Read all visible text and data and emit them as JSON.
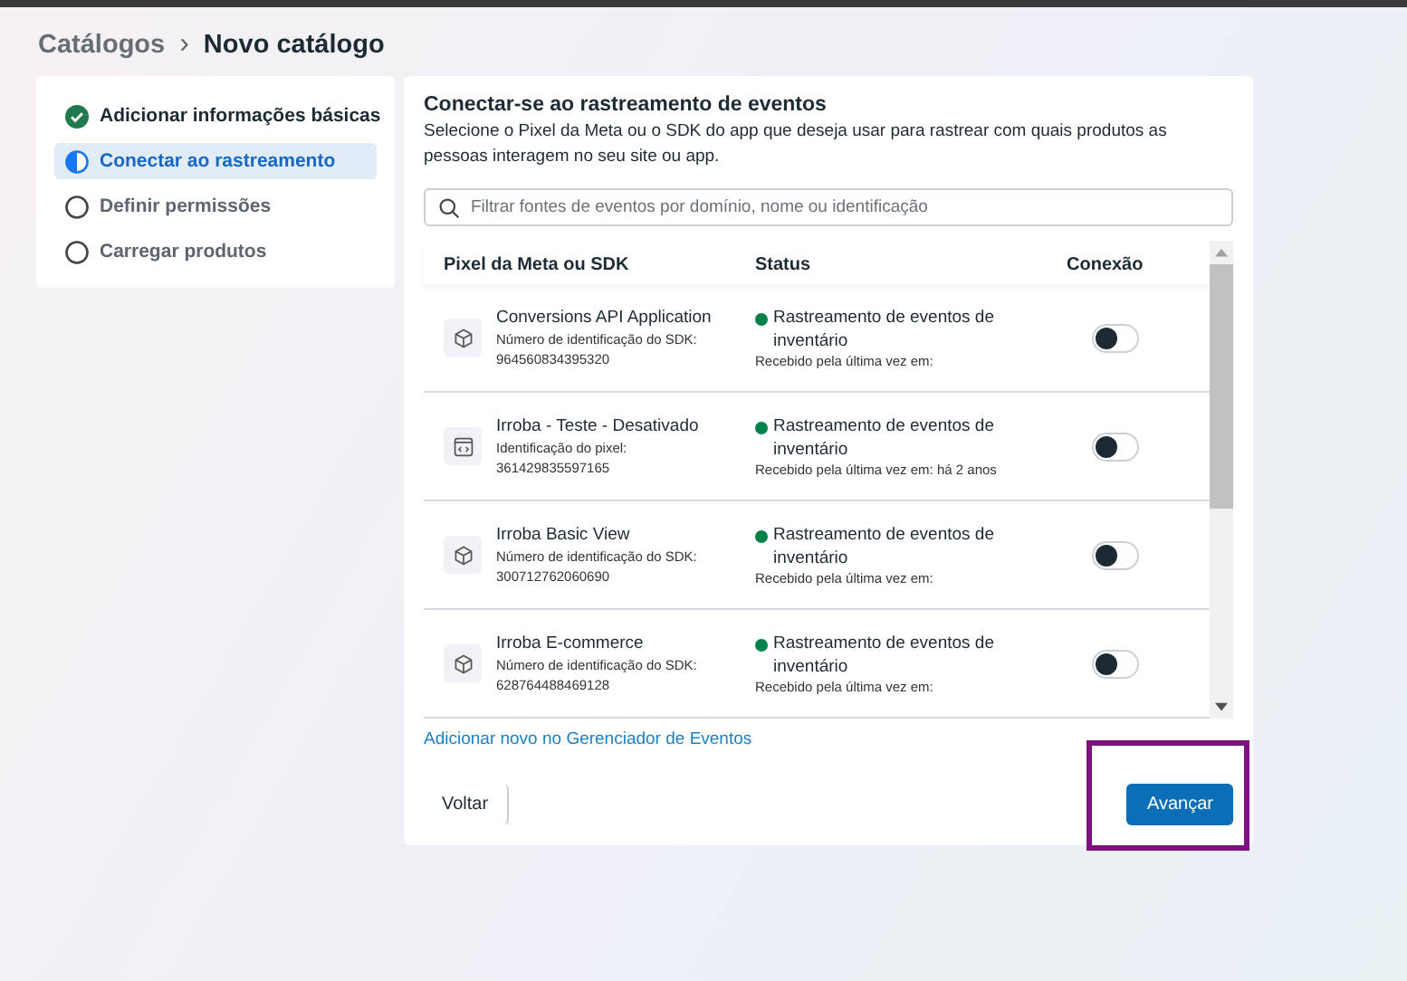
{
  "breadcrumb": {
    "parent": "Catálogos",
    "separator": "›",
    "current": "Novo catálogo"
  },
  "steps": [
    {
      "label": "Adicionar informações básicas",
      "kind": "done",
      "selected": false
    },
    {
      "label": "Conectar ao rastreamento",
      "kind": "current",
      "selected": true
    },
    {
      "label": "Definir permissões",
      "kind": "pending",
      "selected": false
    },
    {
      "label": "Carregar produtos",
      "kind": "pending",
      "selected": false
    }
  ],
  "panel": {
    "title": "Conectar-se ao rastreamento de eventos",
    "description": "Selecione o Pixel da Meta ou o SDK do app que deseja usar para rastrear com quais produtos as pessoas interagem no seu site ou app.",
    "search": {
      "placeholder": "Filtrar fontes de eventos por domínio, nome ou identificação"
    }
  },
  "table": {
    "columns": [
      "Pixel da Meta ou SDK",
      "Status",
      "Conexão"
    ],
    "rows": [
      {
        "kind": "sdk",
        "name": "Conversions API Application",
        "id_label": "Número de identificação do SDK:",
        "id": "964560834395320",
        "status": "Rastreamento de eventos de inventário",
        "color": "#00804a",
        "received": "Recebido pela última vez em:",
        "on": false
      },
      {
        "kind": "pixel",
        "name": "Irroba - Teste - Desativado",
        "id_label": "Identificação do pixel:",
        "id": "361429835597165",
        "status": "Rastreamento de eventos de inventário",
        "color": "#00804a",
        "received": "Recebido pela última vez em: há 2 anos",
        "on": false
      },
      {
        "kind": "sdk",
        "name": "Irroba Basic View",
        "id_label": "Número de identificação do SDK:",
        "id": "300712762060690",
        "status": "Rastreamento de eventos de inventário",
        "color": "#00804a",
        "received": "Recebido pela última vez em:",
        "on": false
      },
      {
        "kind": "sdk",
        "name": "Irroba E-commerce",
        "id_label": "Número de identificação do SDK:",
        "id": "628764488469128",
        "status": "Rastreamento de eventos de inventário",
        "color": "#00804a",
        "received": "Recebido pela última vez em:",
        "on": false
      }
    ]
  },
  "link": "Adicionar novo no Gerenciador de Eventos",
  "buttons": {
    "back": "Voltar",
    "next": "Avançar"
  },
  "highlight": true
}
